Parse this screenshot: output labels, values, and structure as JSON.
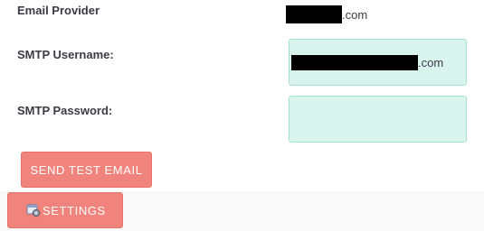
{
  "form": {
    "provider_label": "Email Provider",
    "provider_value_suffix": ".com",
    "username_label": "SMTP Username:",
    "username_value_suffix": ".com",
    "password_label": "SMTP Password:",
    "password_value": ""
  },
  "buttons": {
    "send_test_email": "SEND TEST EMAIL",
    "settings": "SETTINGS"
  },
  "icons": {
    "settings": "gear-icon"
  },
  "colors": {
    "button_bg": "#f0837b",
    "field_bg": "#d9f4ec",
    "field_border": "#a8e2cf"
  }
}
